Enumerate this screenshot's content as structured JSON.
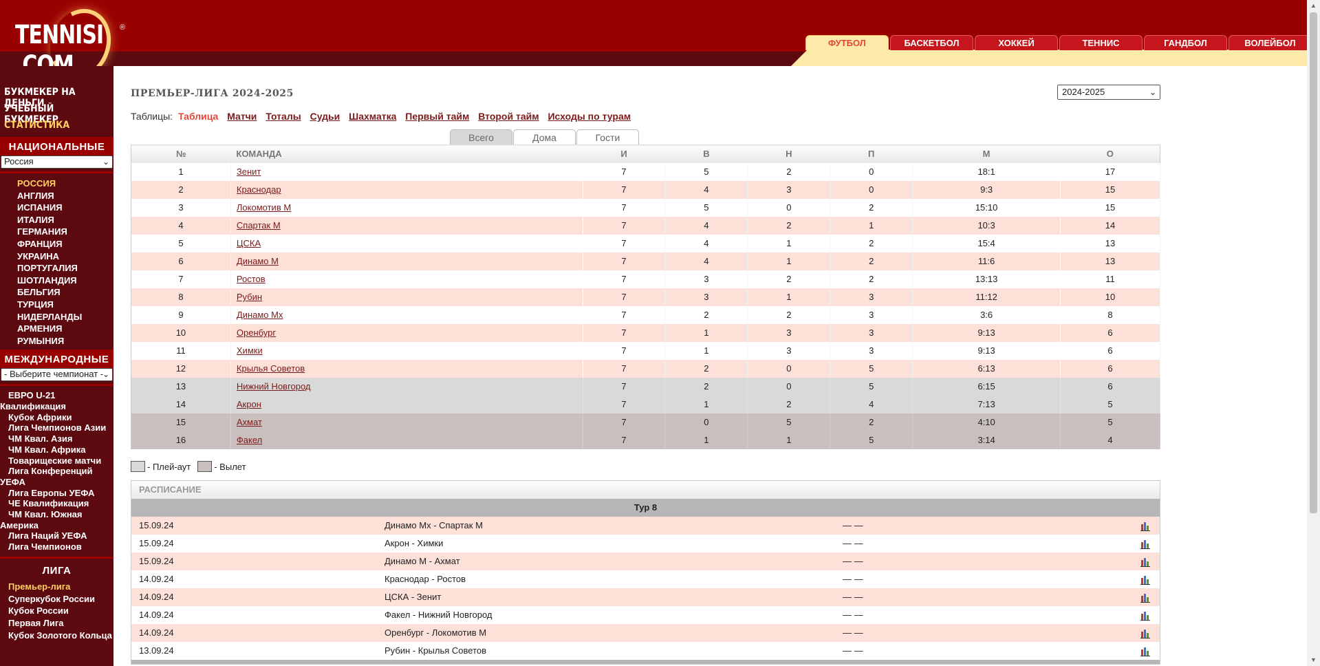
{
  "header": {
    "logo_text": "TENNISI .COM",
    "logo_reg": "®",
    "sport_tabs": [
      "ФУТБОЛ",
      "БАСКЕТБОЛ",
      "ХОККЕЙ",
      "ТЕННИС",
      "ГАНДБОЛ",
      "ВОЛЕЙБОЛ"
    ]
  },
  "sidebar": {
    "top_links": [
      "БУКМЕКЕР НА ДЕНЬГИ",
      "УЧЕБНЫЙ БУКМЕКЕР",
      "СТАТИСТИКА"
    ],
    "national_heading": "НАЦИОНАЛЬНЫЕ",
    "national_select": "Россия",
    "countries": [
      "РОССИЯ",
      "АНГЛИЯ",
      "ИСПАНИЯ",
      "ИТАЛИЯ",
      "ГЕРМАНИЯ",
      "ФРАНЦИЯ",
      "УКРАИНА",
      "ПОРТУГАЛИЯ",
      "ШОТЛАНДИЯ",
      "БЕЛЬГИЯ",
      "ТУРЦИЯ",
      "НИДЕРЛАНДЫ",
      "АРМЕНИЯ",
      "РУМЫНИЯ"
    ],
    "international_heading": "МЕЖДУНАРОДНЫЕ",
    "international_select": "- Выберите чемпионат -",
    "international": [
      "ЕВРО U-21 Квалификация",
      "Кубок Африки",
      "Лига Чемпионов Азии",
      "ЧМ Квал. Азия",
      "ЧМ Квал. Африка",
      "Товарищеские матчи",
      "Лига Конференций УЕФА",
      "Лига Европы УЕФА",
      "ЧЕ Квалификация",
      "ЧМ Квал. Южная Америка",
      "Лига Наций УЕФА",
      "Лига Чемпионов"
    ],
    "league_heading": "ЛИГА",
    "leagues": [
      "Премьер-лига",
      "Суперкубок России",
      "Кубок России",
      "Первая Лига",
      "Кубок Золотого Кольца"
    ]
  },
  "main": {
    "title": "ПРЕМЬЕР-ЛИГА 2024-2025",
    "season": "2024-2025",
    "tables_label": "Таблицы:",
    "tables_links": [
      "Таблица",
      "Матчи",
      "Тоталы",
      "Судьи",
      "Шахматка",
      "Первый тайм",
      "Второй тайм",
      "Исходы по турам"
    ],
    "venue_tabs": [
      "Всего",
      "Дома",
      "Гости"
    ],
    "columns": [
      "№",
      "КОМАНДА",
      "И",
      "В",
      "Н",
      "П",
      "М",
      "О"
    ],
    "rows": [
      {
        "n": "1",
        "team": "Зенит",
        "i": "7",
        "w": "5",
        "d": "2",
        "l": "0",
        "g": "18:1",
        "p": "17",
        "zone": ""
      },
      {
        "n": "2",
        "team": "Краснодар",
        "i": "7",
        "w": "4",
        "d": "3",
        "l": "0",
        "g": "9:3",
        "p": "15",
        "zone": ""
      },
      {
        "n": "3",
        "team": "Локомотив М",
        "i": "7",
        "w": "5",
        "d": "0",
        "l": "2",
        "g": "15:10",
        "p": "15",
        "zone": ""
      },
      {
        "n": "4",
        "team": "Спартак М",
        "i": "7",
        "w": "4",
        "d": "2",
        "l": "1",
        "g": "10:3",
        "p": "14",
        "zone": ""
      },
      {
        "n": "5",
        "team": "ЦСКА",
        "i": "7",
        "w": "4",
        "d": "1",
        "l": "2",
        "g": "15:4",
        "p": "13",
        "zone": ""
      },
      {
        "n": "6",
        "team": "Динамо М",
        "i": "7",
        "w": "4",
        "d": "1",
        "l": "2",
        "g": "11:6",
        "p": "13",
        "zone": ""
      },
      {
        "n": "7",
        "team": "Ростов",
        "i": "7",
        "w": "3",
        "d": "2",
        "l": "2",
        "g": "13:13",
        "p": "11",
        "zone": ""
      },
      {
        "n": "8",
        "team": "Рубин",
        "i": "7",
        "w": "3",
        "d": "1",
        "l": "3",
        "g": "11:12",
        "p": "10",
        "zone": ""
      },
      {
        "n": "9",
        "team": "Динамо Мх",
        "i": "7",
        "w": "2",
        "d": "2",
        "l": "3",
        "g": "3:6",
        "p": "8",
        "zone": ""
      },
      {
        "n": "10",
        "team": "Оренбург",
        "i": "7",
        "w": "1",
        "d": "3",
        "l": "3",
        "g": "9:13",
        "p": "6",
        "zone": ""
      },
      {
        "n": "11",
        "team": "Химки",
        "i": "7",
        "w": "1",
        "d": "3",
        "l": "3",
        "g": "9:13",
        "p": "6",
        "zone": ""
      },
      {
        "n": "12",
        "team": "Крылья Советов",
        "i": "7",
        "w": "2",
        "d": "0",
        "l": "5",
        "g": "6:13",
        "p": "6",
        "zone": ""
      },
      {
        "n": "13",
        "team": "Нижний Новгород",
        "i": "7",
        "w": "2",
        "d": "0",
        "l": "5",
        "g": "6:15",
        "p": "6",
        "zone": "playoff"
      },
      {
        "n": "14",
        "team": "Акрон",
        "i": "7",
        "w": "1",
        "d": "2",
        "l": "4",
        "g": "7:13",
        "p": "5",
        "zone": "playoff"
      },
      {
        "n": "15",
        "team": "Ахмат",
        "i": "7",
        "w": "0",
        "d": "5",
        "l": "2",
        "g": "4:10",
        "p": "5",
        "zone": "releg"
      },
      {
        "n": "16",
        "team": "Факел",
        "i": "7",
        "w": "1",
        "d": "1",
        "l": "5",
        "g": "3:14",
        "p": "4",
        "zone": "releg"
      }
    ],
    "legend_playoff": "- Плей-аут",
    "legend_releg": "- Вылет",
    "schedule_heading": "РАСПИСАНИЕ",
    "round": "Тур 8",
    "matches": [
      {
        "date": "15.09.24",
        "teams": "Динамо Мх - Спартак М",
        "score": "— —"
      },
      {
        "date": "15.09.24",
        "teams": "Акрон - Химки",
        "score": "— —"
      },
      {
        "date": "15.09.24",
        "teams": "Динамо М - Ахмат",
        "score": "— —"
      },
      {
        "date": "14.09.24",
        "teams": "Краснодар - Ростов",
        "score": "— —"
      },
      {
        "date": "14.09.24",
        "teams": "ЦСКА - Зенит",
        "score": "— —"
      },
      {
        "date": "14.09.24",
        "teams": "Факел - Нижний Новгород",
        "score": "— —"
      },
      {
        "date": "14.09.24",
        "teams": "Оренбург - Локомотив М",
        "score": "— —"
      },
      {
        "date": "13.09.24",
        "teams": "Рубин - Крылья Советов",
        "score": "— —"
      }
    ]
  }
}
